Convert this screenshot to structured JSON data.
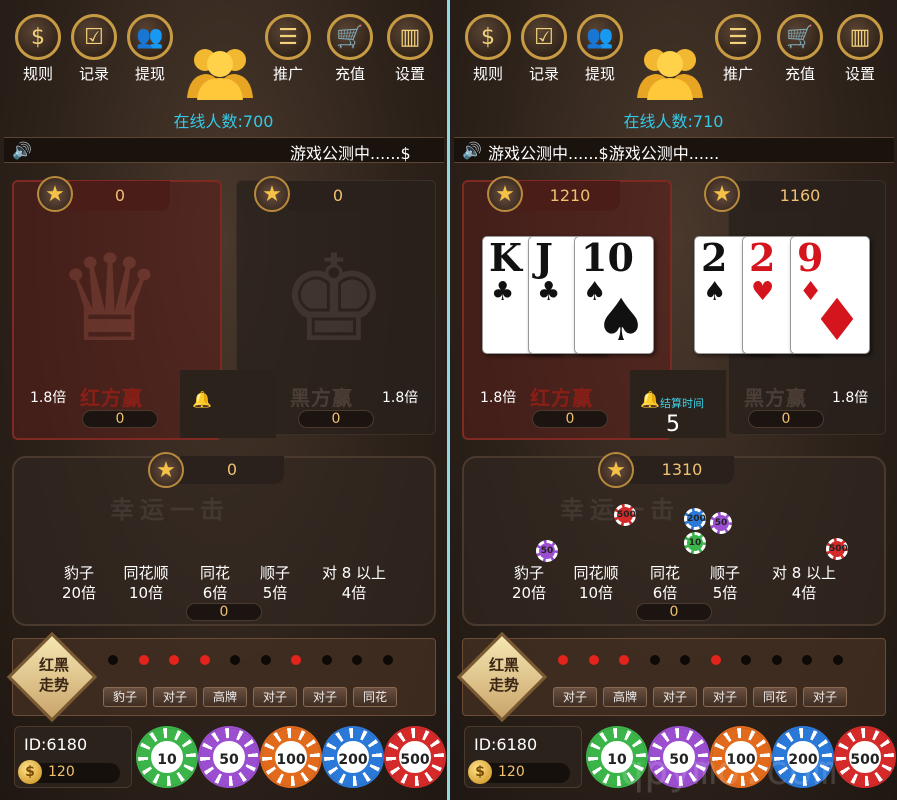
{
  "menu": {
    "rules": "规则",
    "records": "记录",
    "withdraw": "提现",
    "promote": "推广",
    "recharge": "充值",
    "settings": "设置"
  },
  "icons": {
    "rules": "rules-icon",
    "records": "records-icon",
    "withdraw": "withdraw-icon",
    "promote": "list-icon",
    "recharge": "cart-icon",
    "settings": "podium-icon"
  },
  "left": {
    "online": "在线人数:700",
    "marquee": "游戏公测中......$",
    "red_score": "0",
    "black_score": "0",
    "red_mult": "1.8倍",
    "black_mult": "1.8倍",
    "red_bet": "0",
    "black_bet": "0",
    "red_label": "红方赢",
    "black_label": "黑方赢",
    "lucky_score": "0",
    "lucky_bet": "0",
    "trend_results": [
      "豹子",
      "对子",
      "高牌",
      "对子",
      "对子",
      "同花"
    ]
  },
  "right": {
    "online": "在线人数:710",
    "marquee": "游戏公测中......$游戏公测中......",
    "red_score": "1210",
    "black_score": "1160",
    "red_mult": "1.8倍",
    "black_mult": "1.8倍",
    "red_bet": "0",
    "black_bet": "0",
    "red_label": "红方赢",
    "black_label": "黑方赢",
    "settle_label": "结算时间",
    "settle_count": "5",
    "lucky_score": "1310",
    "lucky_bet": "0",
    "red_cards": [
      {
        "rank": "K",
        "suit": "♣"
      },
      {
        "rank": "J",
        "suit": "♣"
      },
      {
        "rank": "10",
        "suit": "♠"
      }
    ],
    "black_cards": [
      {
        "rank": "2",
        "suit": "♠"
      },
      {
        "rank": "2",
        "suit": "♥"
      },
      {
        "rank": "9",
        "suit": "♦"
      }
    ],
    "trend_results": [
      "对子",
      "高牌",
      "对子",
      "对子",
      "同花",
      "对子"
    ]
  },
  "lucky_title": "幸运一击",
  "lucky_odds": [
    {
      "name": "豹子",
      "mult": "20倍"
    },
    {
      "name": "同花顺",
      "mult": "10倍"
    },
    {
      "name": "同花",
      "mult": "6倍"
    },
    {
      "name": "顺子",
      "mult": "5倍"
    },
    {
      "name": "对 8 以上",
      "mult": "4倍"
    }
  ],
  "trend_label_1": "红黑",
  "trend_label_2": "走势",
  "trend_dots_left": [
    "black",
    "red",
    "red",
    "red",
    "black",
    "black",
    "red",
    "black",
    "black",
    "black"
  ],
  "trend_dots_right": [
    "red",
    "red",
    "red",
    "black",
    "black",
    "red",
    "black",
    "black",
    "black",
    "black"
  ],
  "player": {
    "id": "ID:6180",
    "coins": "120"
  },
  "chips": [
    "10",
    "50",
    "100",
    "200",
    "500"
  ],
  "chip_colors": [
    "#3bb54a",
    "#9b4fd0",
    "#e26a1c",
    "#2a78d8",
    "#d42a2a"
  ],
  "placed_chips": [
    "500",
    "200",
    "50",
    "10",
    "50",
    "500"
  ],
  "watermark": "qpymo.com"
}
